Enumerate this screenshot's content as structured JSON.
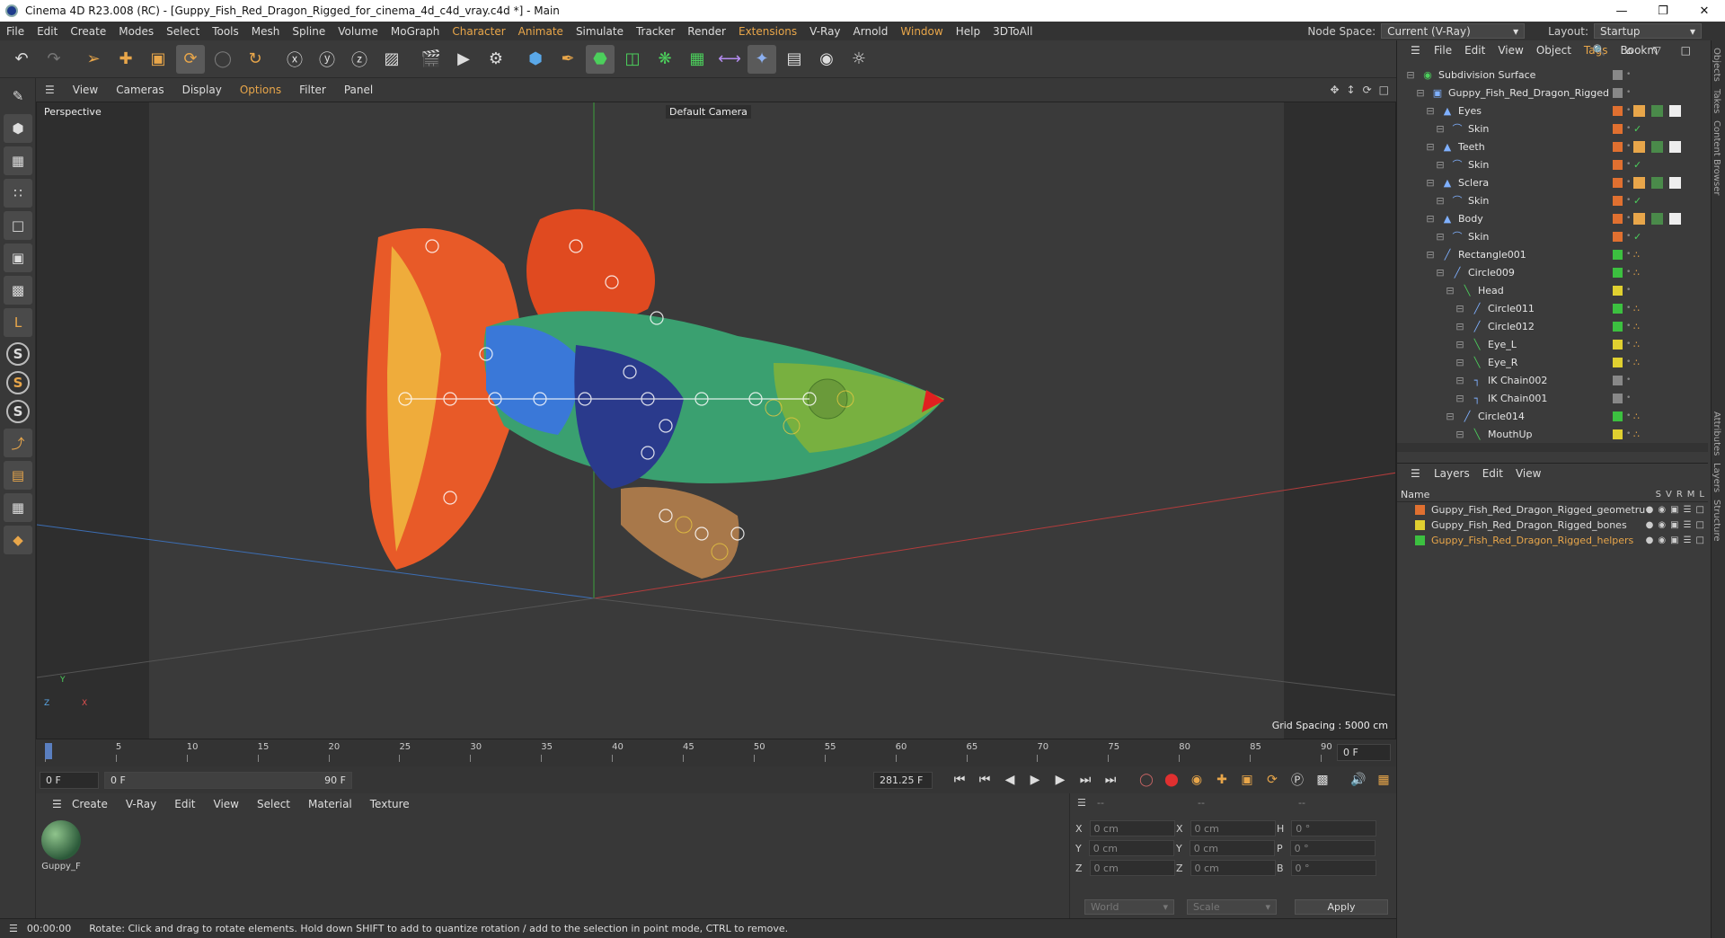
{
  "title": "Cinema 4D R23.008 (RC) - [Guppy_Fish_Red_Dragon_Rigged_for_cinema_4d_c4d_vray.c4d *] - Main",
  "menus": [
    "File",
    "Edit",
    "Create",
    "Modes",
    "Select",
    "Tools",
    "Mesh",
    "Spline",
    "Volume",
    "MoGraph",
    "Character",
    "Animate",
    "Simulate",
    "Tracker",
    "Render",
    "Extensions",
    "V-Ray",
    "Arnold",
    "Window",
    "Help",
    "3DToAll"
  ],
  "node_space": {
    "label": "Node Space:",
    "value": "Current (V-Ray)"
  },
  "layout": {
    "label": "Layout:",
    "value": "Startup"
  },
  "viewport": {
    "menu": [
      "View",
      "Cameras",
      "Display",
      "Options",
      "Filter",
      "Panel"
    ],
    "label": "Perspective",
    "camera": "Default Camera",
    "grid": "Grid Spacing : 5000 cm",
    "axes": {
      "y": "Y",
      "z": "Z",
      "x": "X"
    }
  },
  "timeline": {
    "ticks": [
      "0",
      "5",
      "10",
      "15",
      "20",
      "25",
      "30",
      "35",
      "40",
      "45",
      "50",
      "55",
      "60",
      "65",
      "70",
      "75",
      "80",
      "85",
      "90"
    ],
    "current": "0 F",
    "start": "0 F",
    "range_start": "0 F",
    "range_end": "90 F",
    "fps": "281.25 F"
  },
  "material": {
    "menu": [
      "Create",
      "V-Ray",
      "Edit",
      "View",
      "Select",
      "Material",
      "Texture"
    ],
    "item": "Guppy_F"
  },
  "coords": {
    "hdr": [
      "--",
      "--",
      "--"
    ],
    "rows": [
      {
        "a": "X",
        "av": "0 cm",
        "b": "X",
        "bv": "0 cm",
        "c": "H",
        "cv": "0 °"
      },
      {
        "a": "Y",
        "av": "0 cm",
        "b": "Y",
        "bv": "0 cm",
        "c": "P",
        "cv": "0 °"
      },
      {
        "a": "Z",
        "av": "0 cm",
        "b": "Z",
        "bv": "0 cm",
        "c": "B",
        "cv": "0 °"
      }
    ],
    "world": "World",
    "scale": "Scale",
    "apply": "Apply"
  },
  "status": {
    "time": "00:00:00",
    "text": "Rotate: Click and drag to rotate elements. Hold down SHIFT to add to quantize rotation / add to the selection in point mode, CTRL to remove."
  },
  "objects": {
    "menu": [
      "File",
      "Edit",
      "View",
      "Object",
      "Tags",
      "Bookm"
    ],
    "rows": [
      {
        "name": "Subdivision Surface",
        "ind": 0,
        "color": "#888"
      },
      {
        "name": "Guppy_Fish_Red_Dragon_Rigged",
        "ind": 1,
        "color": "#888"
      },
      {
        "name": "Eyes",
        "ind": 2,
        "color": "#e07030"
      },
      {
        "name": "Skin",
        "ind": 3,
        "color": "#e07030"
      },
      {
        "name": "Teeth",
        "ind": 2,
        "color": "#e07030"
      },
      {
        "name": "Skin",
        "ind": 3,
        "color": "#e07030"
      },
      {
        "name": "Sclera",
        "ind": 2,
        "color": "#e07030"
      },
      {
        "name": "Skin",
        "ind": 3,
        "color": "#e07030"
      },
      {
        "name": "Body",
        "ind": 2,
        "color": "#e07030"
      },
      {
        "name": "Skin",
        "ind": 3,
        "color": "#e07030"
      },
      {
        "name": "Rectangle001",
        "ind": 2,
        "color": "#3cc040"
      },
      {
        "name": "Circle009",
        "ind": 3,
        "color": "#3cc040"
      },
      {
        "name": "Head",
        "ind": 4,
        "color": "#e0d030"
      },
      {
        "name": "Circle011",
        "ind": 5,
        "color": "#3cc040"
      },
      {
        "name": "Circle012",
        "ind": 5,
        "color": "#3cc040"
      },
      {
        "name": "Eye_L",
        "ind": 5,
        "color": "#e0d030"
      },
      {
        "name": "Eye_R",
        "ind": 5,
        "color": "#e0d030"
      },
      {
        "name": "IK Chain002",
        "ind": 5,
        "color": "#888"
      },
      {
        "name": "IK Chain001",
        "ind": 5,
        "color": "#888"
      },
      {
        "name": "Circle014",
        "ind": 4,
        "color": "#3cc040"
      },
      {
        "name": "MouthUp",
        "ind": 5,
        "color": "#e0d030"
      }
    ]
  },
  "layers": {
    "menu": [
      "Layers",
      "Edit",
      "View"
    ],
    "cols": [
      "Name",
      "S",
      "V",
      "R",
      "M",
      "L"
    ],
    "rows": [
      {
        "name": "Guppy_Fish_Red_Dragon_Rigged_geometru",
        "color": "#e07030",
        "text": "#dddddd"
      },
      {
        "name": "Guppy_Fish_Red_Dragon_Rigged_bones",
        "color": "#e0d030",
        "text": "#dddddd"
      },
      {
        "name": "Guppy_Fish_Red_Dragon_Rigged_helpers",
        "color": "#3cc040",
        "text": "#e8a64a"
      }
    ]
  },
  "side_tabs": [
    "Objects",
    "Takes",
    "Content Browser",
    "Attributes",
    "Layers",
    "Structure"
  ]
}
